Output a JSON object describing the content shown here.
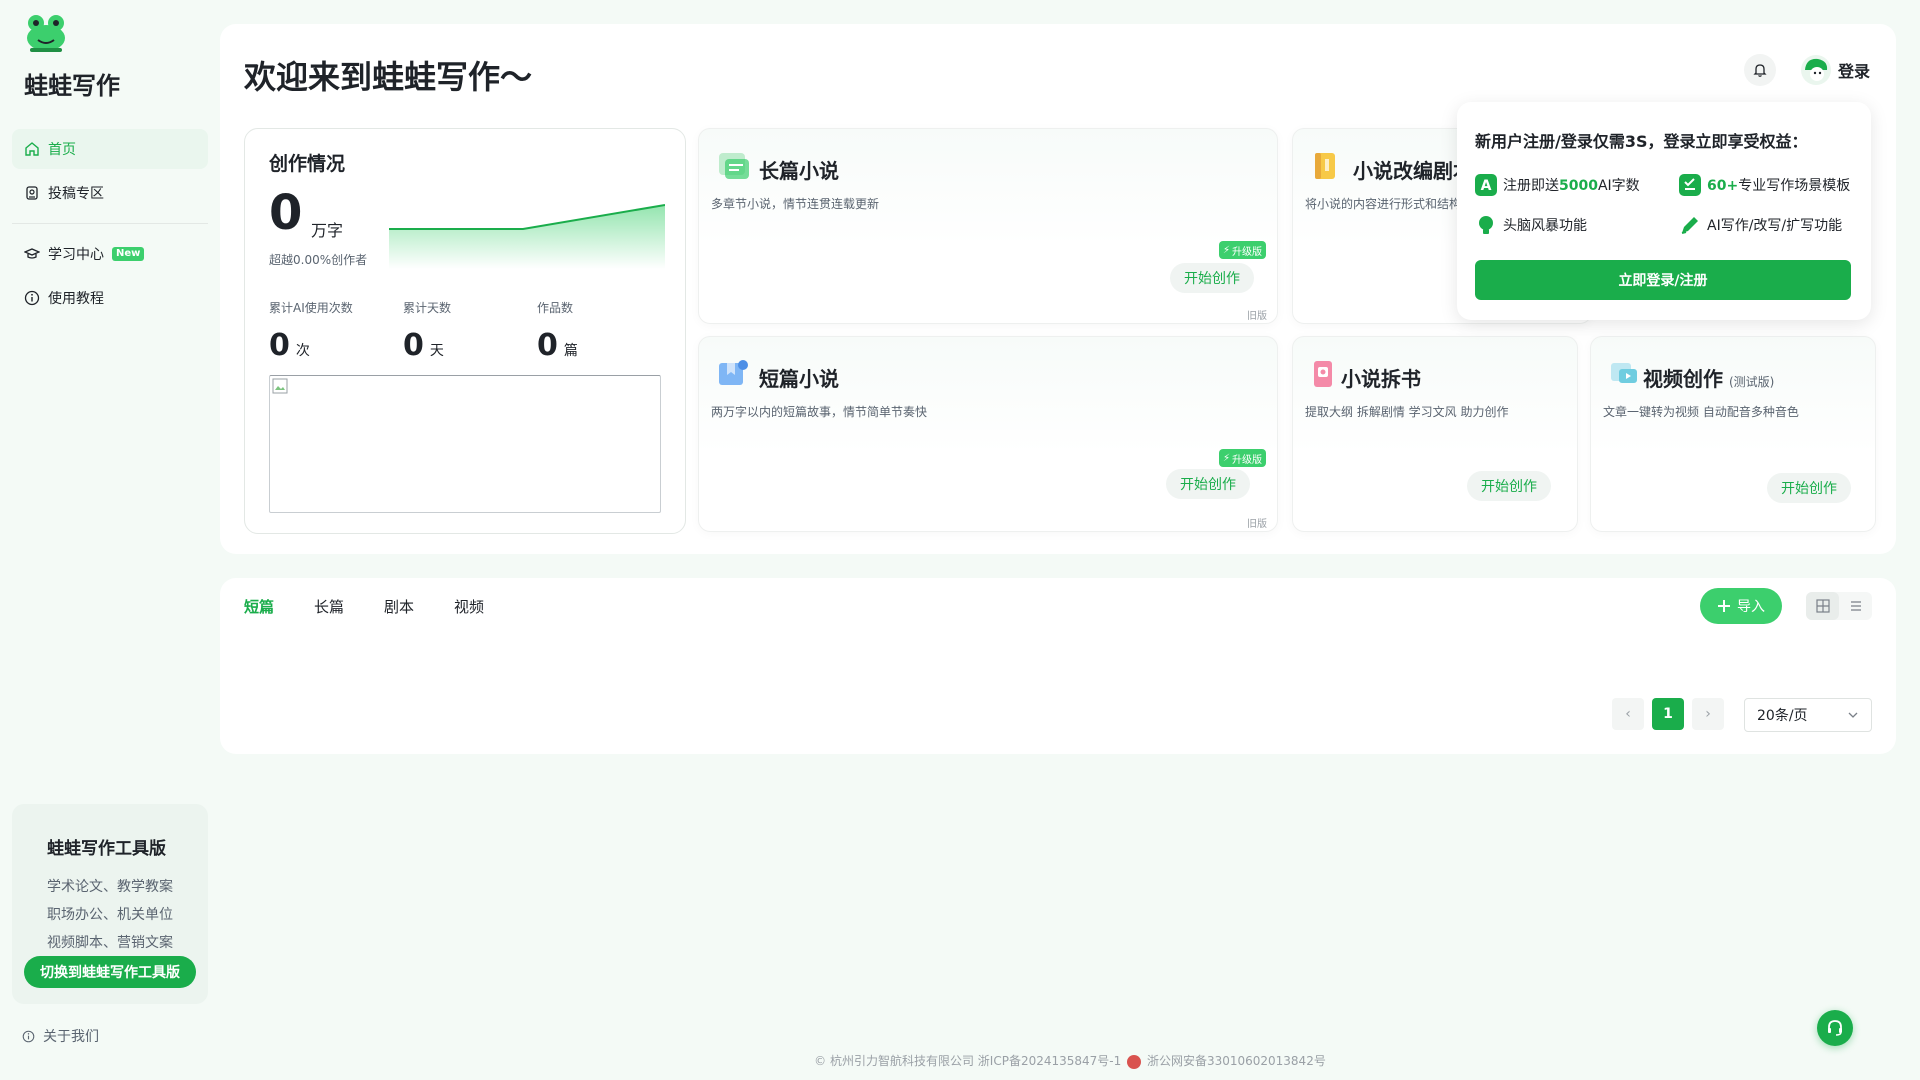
{
  "app": {
    "name": "蛙蛙写作"
  },
  "sidebar": {
    "items": [
      {
        "label": "首页",
        "icon": "home-icon",
        "active": true
      },
      {
        "label": "投稿专区",
        "icon": "submit-icon"
      },
      {
        "label": "学习中心",
        "icon": "graduation-cap-icon",
        "badge": "New"
      },
      {
        "label": "使用教程",
        "icon": "info-icon"
      }
    ],
    "tool_card": {
      "title": "蛙蛙写作工具版",
      "lines": [
        "学术论文、教学教案",
        "职场办公、机关单位",
        "视频脚本、营销文案"
      ],
      "button": "切换到蛙蛙写作工具版"
    },
    "about": "关于我们"
  },
  "header": {
    "welcome": "欢迎来到蛙蛙写作～",
    "login": "登录"
  },
  "stats": {
    "title": "创作情况",
    "words": "0",
    "words_unit": "万字",
    "exceed": "超越0.00%创作者",
    "metrics": [
      {
        "label": "累计AI使用次数",
        "value": "0",
        "unit": "次"
      },
      {
        "label": "累计天数",
        "value": "0",
        "unit": "天"
      },
      {
        "label": "作品数",
        "value": "0",
        "unit": "篇"
      }
    ]
  },
  "cards": {
    "long_novel": {
      "title": "长篇小说",
      "desc": "多章节小说，情节连贯连载更新",
      "button": "开始创作",
      "badge": "升级版",
      "old": "旧版"
    },
    "adapt": {
      "title": "小说改编剧本",
      "desc": "将小说的内容进行形式和结构"
    },
    "short_novel": {
      "title": "短篇小说",
      "desc": "两万字以内的短篇故事，情节简单节奏快",
      "button": "开始创作",
      "badge": "升级版",
      "old": "旧版"
    },
    "breakdown": {
      "title": "小说拆书",
      "desc": "提取大纲 拆解剧情 学习文风 助力创作",
      "button": "开始创作"
    },
    "video": {
      "title": "视频创作",
      "beta": "(测试版)",
      "desc": "文章一键转为视频 自动配音多种音色",
      "button": "开始创作"
    }
  },
  "popup": {
    "title": "新用户注册/登录仅需3S，登录立即享受权益：",
    "perks": [
      {
        "pre": "注册即送",
        "highlight": "5000",
        "post": "AI字数"
      },
      {
        "pre": "",
        "highlight": "60+",
        "post": "专业写作场景模板"
      },
      {
        "pre": "头脑风暴功能",
        "highlight": "",
        "post": ""
      },
      {
        "pre": "AI写作/改写/扩写功能",
        "highlight": "",
        "post": ""
      }
    ],
    "button": "立即登录/注册"
  },
  "works": {
    "tabs": [
      "短篇",
      "长篇",
      "剧本",
      "视频"
    ],
    "active_tab": "短篇",
    "import": "导入",
    "page": "1",
    "per_page": "20条/页"
  },
  "footer": {
    "company": "© 杭州引力智航科技有限公司 浙ICP备2024135847号-1",
    "police": "浙公网安备33010602013842号"
  },
  "colors": {
    "accent": "#1aad4b",
    "accent_light": "#3ccf6d"
  }
}
